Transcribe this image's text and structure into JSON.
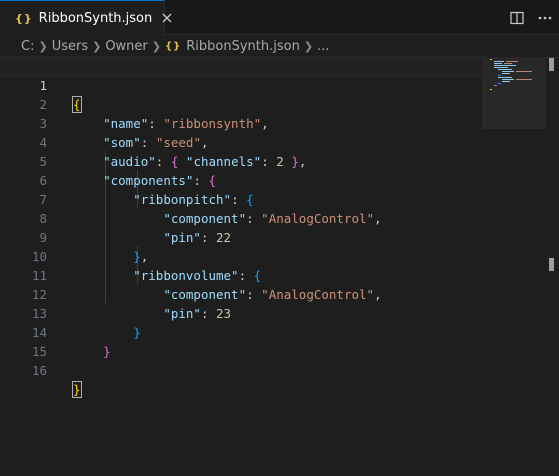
{
  "tab": {
    "icon": "{}",
    "label": "RibbonSynth.json"
  },
  "breadcrumb": {
    "parts": [
      "C:",
      "Users",
      "Owner"
    ],
    "file_icon": "{}",
    "file": "RibbonSynth.json",
    "more": "..."
  },
  "editor": {
    "line_numbers": [
      "1",
      "2",
      "3",
      "4",
      "5",
      "6",
      "7",
      "8",
      "9",
      "10",
      "11",
      "12",
      "13",
      "14",
      "15",
      "16"
    ],
    "tokens": {
      "name_key": "\"name\"",
      "name_val": "\"ribbonsynth\"",
      "som_key": "\"som\"",
      "som_val": "\"seed\"",
      "audio_key": "\"audio\"",
      "channels_key": "\"channels\"",
      "channels_val": "2",
      "components_key": "\"components\"",
      "ribbonpitch_key": "\"ribbonpitch\"",
      "component_key": "\"component\"",
      "component_val": "\"AnalogControl\"",
      "pin_key": "\"pin\"",
      "pin1_val": "22",
      "ribbonvolume_key": "\"ribbonvolume\"",
      "pin2_val": "23"
    }
  },
  "colors": {
    "accent": "#0078d4",
    "key": "#9cdcfe",
    "string": "#ce9178",
    "number": "#b5cea8",
    "bracket1": "#ffd700",
    "bracket2": "#da70d6",
    "bracket3": "#179fff"
  },
  "icons": [
    "json-icon",
    "close-icon",
    "split-editor-icon",
    "more-actions-icon",
    "chevron-right-icon"
  ]
}
